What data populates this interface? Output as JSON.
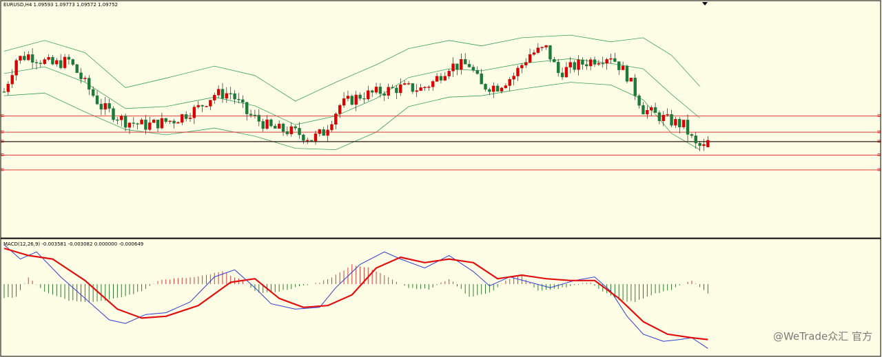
{
  "main_title": "EURUSD,H4  1.09593 1.09773 1.09572 1.09752",
  "macd_title": "MACD(12,26,9) -0.003581 -0.003082 0.000000 -0.000649",
  "watermark": "@WeTrade众汇 官方",
  "colors": {
    "background": "#fefee6",
    "bull_candle": "#d80000",
    "bear_candle": "#1c7a3a",
    "bollinger": "#3aa05a",
    "level_line": "#e23a3a",
    "price_line": "#000000",
    "hist_positive": "#d33a3a",
    "hist_negative": "#2e7d2e",
    "macd_line": "#2b3bd4",
    "signal_line": "#e01010"
  },
  "chart_data": [
    {
      "type": "candlestick",
      "title": "EURUSD,H4  1.09593 1.09773 1.09572 1.09752",
      "symbol": "EURUSD",
      "timeframe": "H4",
      "ohlc_last": {
        "open": 1.09593,
        "high": 1.09773,
        "low": 1.09572,
        "close": 1.09752
      },
      "indicators": [
        "Bollinger Bands"
      ],
      "horizontal_levels": 5,
      "grid": false,
      "legend": "none",
      "anchors": [
        {
          "i": 0,
          "p": 1.0908
        },
        {
          "i": 3,
          "p": 1.0932
        },
        {
          "i": 6,
          "p": 1.0935
        },
        {
          "i": 12,
          "p": 1.0928
        },
        {
          "i": 16,
          "p": 1.0931
        },
        {
          "i": 20,
          "p": 1.0914
        },
        {
          "i": 24,
          "p": 1.0897
        },
        {
          "i": 30,
          "p": 1.0886
        },
        {
          "i": 35,
          "p": 1.0883
        },
        {
          "i": 42,
          "p": 1.0887
        },
        {
          "i": 48,
          "p": 1.0896
        },
        {
          "i": 52,
          "p": 1.0906
        },
        {
          "i": 56,
          "p": 1.0907
        },
        {
          "i": 60,
          "p": 1.0892
        },
        {
          "i": 66,
          "p": 1.0881
        },
        {
          "i": 72,
          "p": 1.0878
        },
        {
          "i": 76,
          "p": 1.0873
        },
        {
          "i": 79,
          "p": 1.0878
        },
        {
          "i": 83,
          "p": 1.0898
        },
        {
          "i": 88,
          "p": 1.0905
        },
        {
          "i": 93,
          "p": 1.0908
        },
        {
          "i": 98,
          "p": 1.0911
        },
        {
          "i": 103,
          "p": 1.091
        },
        {
          "i": 106,
          "p": 1.0915
        },
        {
          "i": 110,
          "p": 1.0927
        },
        {
          "i": 115,
          "p": 1.0928
        },
        {
          "i": 118,
          "p": 1.0912
        },
        {
          "i": 122,
          "p": 1.0912
        },
        {
          "i": 126,
          "p": 1.092
        },
        {
          "i": 130,
          "p": 1.0936
        },
        {
          "i": 134,
          "p": 1.094
        },
        {
          "i": 137,
          "p": 1.0922
        },
        {
          "i": 142,
          "p": 1.0928
        },
        {
          "i": 146,
          "p": 1.0932
        },
        {
          "i": 150,
          "p": 1.0935
        },
        {
          "i": 154,
          "p": 1.092
        },
        {
          "i": 158,
          "p": 1.0895
        },
        {
          "i": 164,
          "p": 1.0887
        },
        {
          "i": 168,
          "p": 1.0883
        },
        {
          "i": 171,
          "p": 1.0868
        },
        {
          "i": 174,
          "p": 1.0866
        }
      ],
      "bollinger_upper": [
        {
          "i": 0,
          "p": 1.0938
        },
        {
          "i": 10,
          "p": 1.0946
        },
        {
          "i": 20,
          "p": 1.0937
        },
        {
          "i": 30,
          "p": 1.0911
        },
        {
          "i": 40,
          "p": 1.0918
        },
        {
          "i": 52,
          "p": 1.0927
        },
        {
          "i": 62,
          "p": 1.092
        },
        {
          "i": 72,
          "p": 1.0901
        },
        {
          "i": 82,
          "p": 1.0915
        },
        {
          "i": 92,
          "p": 1.0928
        },
        {
          "i": 100,
          "p": 1.094
        },
        {
          "i": 110,
          "p": 1.0946
        },
        {
          "i": 118,
          "p": 1.0942
        },
        {
          "i": 128,
          "p": 1.0948
        },
        {
          "i": 140,
          "p": 1.095
        },
        {
          "i": 150,
          "p": 1.0945
        },
        {
          "i": 158,
          "p": 1.0948
        },
        {
          "i": 165,
          "p": 1.0935
        },
        {
          "i": 172,
          "p": 1.0912
        }
      ],
      "bollinger_lower": [
        {
          "i": 0,
          "p": 1.0905
        },
        {
          "i": 10,
          "p": 1.0907
        },
        {
          "i": 20,
          "p": 1.0893
        },
        {
          "i": 30,
          "p": 1.088
        },
        {
          "i": 40,
          "p": 1.0876
        },
        {
          "i": 52,
          "p": 1.0881
        },
        {
          "i": 62,
          "p": 1.0875
        },
        {
          "i": 72,
          "p": 1.0866
        },
        {
          "i": 82,
          "p": 1.0865
        },
        {
          "i": 92,
          "p": 1.0878
        },
        {
          "i": 100,
          "p": 1.0897
        },
        {
          "i": 110,
          "p": 1.0904
        },
        {
          "i": 118,
          "p": 1.0905
        },
        {
          "i": 128,
          "p": 1.091
        },
        {
          "i": 140,
          "p": 1.0915
        },
        {
          "i": 150,
          "p": 1.0913
        },
        {
          "i": 158,
          "p": 1.0902
        },
        {
          "i": 165,
          "p": 1.0877
        },
        {
          "i": 172,
          "p": 1.0865
        }
      ],
      "levels": [
        1.089,
        1.0878,
        1.0871,
        1.0861,
        1.085
      ],
      "price_line": 1.0871,
      "y_range": [
        1.08,
        1.0975
      ],
      "bars": 175
    },
    {
      "type": "line",
      "title": "MACD(12,26,9) -0.003581 -0.003082 0.000000 -0.000649",
      "params": [
        12,
        26,
        9
      ],
      "values": {
        "macd": -0.003581,
        "signal": -0.003082,
        "level": 0.0,
        "histogram": -0.000649
      },
      "grid": false,
      "legend": "none",
      "series": [
        {
          "values": [
            {
              "i": 0,
              "v": 0.0022
            },
            {
              "i": 4,
              "v": 0.0014
            },
            {
              "i": 8,
              "v": 0.0018
            },
            {
              "i": 14,
              "v": 0.0004
            },
            {
              "i": 20,
              "v": -0.0008
            },
            {
              "i": 26,
              "v": -0.002
            },
            {
              "i": 30,
              "v": -0.0022
            },
            {
              "i": 35,
              "v": -0.0017
            },
            {
              "i": 40,
              "v": -0.0016
            },
            {
              "i": 46,
              "v": -0.001
            },
            {
              "i": 52,
              "v": 0.0004
            },
            {
              "i": 57,
              "v": 0.0008
            },
            {
              "i": 62,
              "v": -0.0002
            },
            {
              "i": 66,
              "v": -0.0011
            },
            {
              "i": 72,
              "v": -0.0014
            },
            {
              "i": 78,
              "v": -0.0013
            },
            {
              "i": 82,
              "v": -0.0002
            },
            {
              "i": 88,
              "v": 0.0011
            },
            {
              "i": 94,
              "v": 0.0018
            },
            {
              "i": 98,
              "v": 0.0014
            },
            {
              "i": 104,
              "v": 0.0009
            },
            {
              "i": 110,
              "v": 0.0016
            },
            {
              "i": 116,
              "v": 0.0007
            },
            {
              "i": 120,
              "v": -0.0001
            },
            {
              "i": 125,
              "v": 0.0004
            },
            {
              "i": 130,
              "v": 0.0001
            },
            {
              "i": 135,
              "v": -0.0002
            },
            {
              "i": 141,
              "v": 0.0002
            },
            {
              "i": 146,
              "v": 0.0004
            },
            {
              "i": 150,
              "v": -0.0004
            },
            {
              "i": 154,
              "v": -0.0018
            },
            {
              "i": 158,
              "v": -0.0028
            },
            {
              "i": 163,
              "v": -0.0032
            },
            {
              "i": 167,
              "v": -0.0031
            },
            {
              "i": 170,
              "v": -0.003
            },
            {
              "i": 174,
              "v": -0.0036
            }
          ]
        },
        {
          "values": [
            {
              "i": 0,
              "v": 0.002
            },
            {
              "i": 6,
              "v": 0.0016
            },
            {
              "i": 12,
              "v": 0.0014
            },
            {
              "i": 20,
              "v": 0.0002
            },
            {
              "i": 28,
              "v": -0.0014
            },
            {
              "i": 34,
              "v": -0.0019
            },
            {
              "i": 40,
              "v": -0.0018
            },
            {
              "i": 48,
              "v": -0.0012
            },
            {
              "i": 56,
              "v": 0.0001
            },
            {
              "i": 62,
              "v": 0.0003
            },
            {
              "i": 68,
              "v": -0.0008
            },
            {
              "i": 74,
              "v": -0.0013
            },
            {
              "i": 80,
              "v": -0.0012
            },
            {
              "i": 86,
              "v": -0.0006
            },
            {
              "i": 92,
              "v": 0.0009
            },
            {
              "i": 98,
              "v": 0.0015
            },
            {
              "i": 104,
              "v": 0.0012
            },
            {
              "i": 110,
              "v": 0.0014
            },
            {
              "i": 116,
              "v": 0.0012
            },
            {
              "i": 122,
              "v": 0.0003
            },
            {
              "i": 128,
              "v": 0.0005
            },
            {
              "i": 134,
              "v": 0.0003
            },
            {
              "i": 140,
              "v": 0.0002
            },
            {
              "i": 146,
              "v": 0.0002
            },
            {
              "i": 152,
              "v": -0.0008
            },
            {
              "i": 158,
              "v": -0.0021
            },
            {
              "i": 164,
              "v": -0.0028
            },
            {
              "i": 170,
              "v": -0.003
            },
            {
              "i": 174,
              "v": -0.0031
            }
          ]
        }
      ],
      "histogram": [
        {
          "i": 0,
          "v": -0.0008
        },
        {
          "i": 3,
          "v": -0.0007
        },
        {
          "i": 6,
          "v": 0.0004
        },
        {
          "i": 10,
          "v": -0.0004
        },
        {
          "i": 16,
          "v": -0.0009
        },
        {
          "i": 22,
          "v": -0.001
        },
        {
          "i": 28,
          "v": -0.0008
        },
        {
          "i": 34,
          "v": -0.0004
        },
        {
          "i": 38,
          "v": 0.0002
        },
        {
          "i": 42,
          "v": 0.0003
        },
        {
          "i": 48,
          "v": 0.0004
        },
        {
          "i": 54,
          "v": 0.0007
        },
        {
          "i": 58,
          "v": 0.0003
        },
        {
          "i": 63,
          "v": -0.0005
        },
        {
          "i": 68,
          "v": -0.0004
        },
        {
          "i": 74,
          "v": -0.0001
        },
        {
          "i": 78,
          "v": 0.0001
        },
        {
          "i": 82,
          "v": 0.0005
        },
        {
          "i": 86,
          "v": 0.0011
        },
        {
          "i": 90,
          "v": 0.0009
        },
        {
          "i": 95,
          "v": 0.0004
        },
        {
          "i": 100,
          "v": -0.0002
        },
        {
          "i": 105,
          "v": -0.0003
        },
        {
          "i": 110,
          "v": 0.0003
        },
        {
          "i": 115,
          "v": -0.0007
        },
        {
          "i": 120,
          "v": -0.0005
        },
        {
          "i": 124,
          "v": 0.0002
        },
        {
          "i": 128,
          "v": 0.0005
        },
        {
          "i": 132,
          "v": -0.0004
        },
        {
          "i": 136,
          "v": -0.0003
        },
        {
          "i": 140,
          "v": -0.0001
        },
        {
          "i": 145,
          "v": 0.0001
        },
        {
          "i": 148,
          "v": -0.0004
        },
        {
          "i": 152,
          "v": -0.0009
        },
        {
          "i": 156,
          "v": -0.001
        },
        {
          "i": 160,
          "v": -0.0006
        },
        {
          "i": 165,
          "v": -0.0003
        },
        {
          "i": 170,
          "v": 0.0002
        },
        {
          "i": 174,
          "v": -0.0005
        }
      ],
      "y_range": [
        -0.004,
        0.0025
      ],
      "bars": 175
    }
  ]
}
